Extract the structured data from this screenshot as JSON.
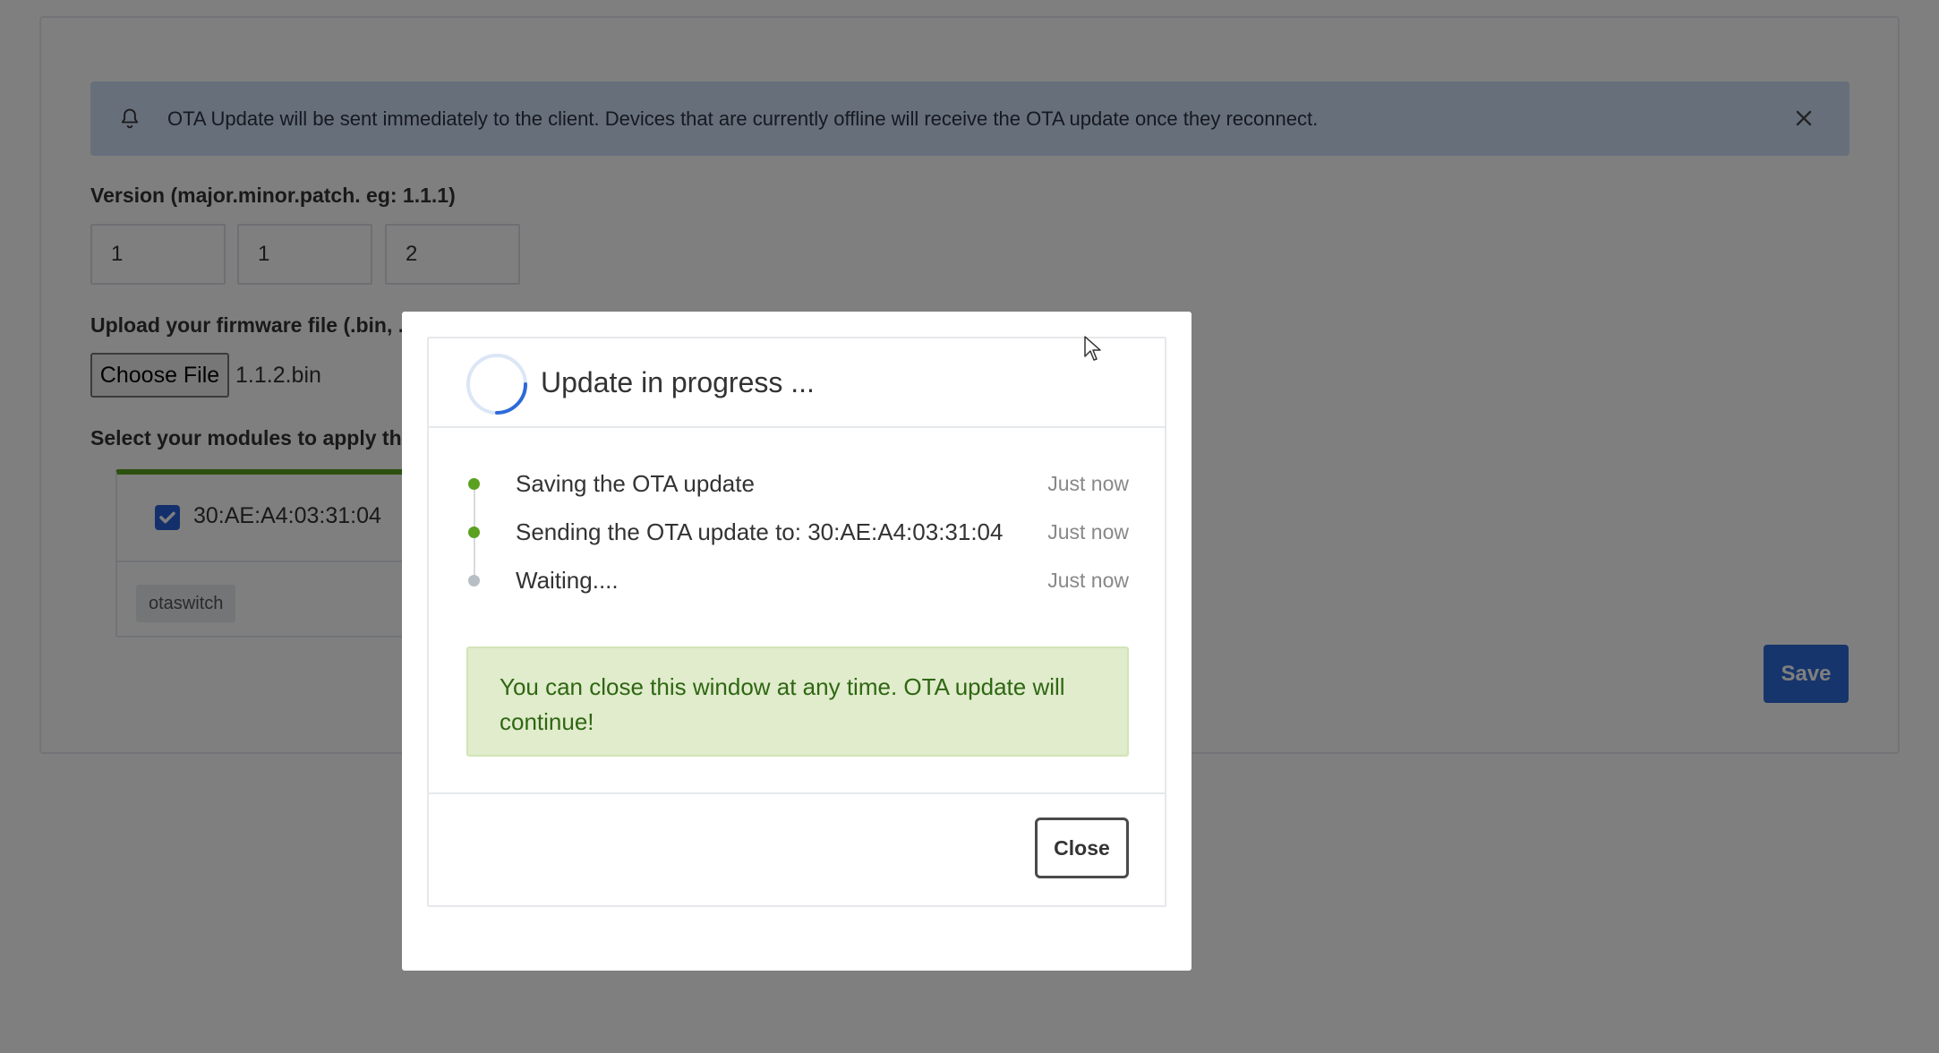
{
  "alert": {
    "message": "OTA Update will be sent immediately to the client. Devices that are currently offline will receive the OTA update once they reconnect.",
    "icon": "bell-icon",
    "close_icon": "close-icon"
  },
  "form": {
    "version_label": "Version (major.minor.patch. eg: 1.1.1)",
    "version": {
      "major": "1",
      "minor": "1",
      "patch": "2"
    },
    "upload_label": "Upload your firmware file (.bin, .t",
    "choose_file_label": "Choose File",
    "file_name": "1.1.2.bin",
    "modules_label": "Select your modules to apply this",
    "module": {
      "mac": "30:AE:A4:03:31:04",
      "checked": true,
      "tag": "otaswitch"
    },
    "save_label": "Save"
  },
  "modal": {
    "title": "Update in progress ...",
    "steps": [
      {
        "text": "Saving the OTA update",
        "time": "Just now",
        "status": "done",
        "color": "#5aa11f"
      },
      {
        "text": "Sending the OTA update to: 30:AE:A4:03:31:04",
        "time": "Just now",
        "status": "done",
        "color": "#5aa11f"
      },
      {
        "text": "Waiting....",
        "time": "Just now",
        "status": "pending",
        "color": "#b8bec6"
      }
    ],
    "note": "You can close this window at any time. OTA update will continue!",
    "close_label": "Close"
  },
  "colors": {
    "accent": "#2d6ad8",
    "success": "#5aa11f",
    "alert_bg": "#cfdff6",
    "note_bg": "#e0eccb"
  }
}
